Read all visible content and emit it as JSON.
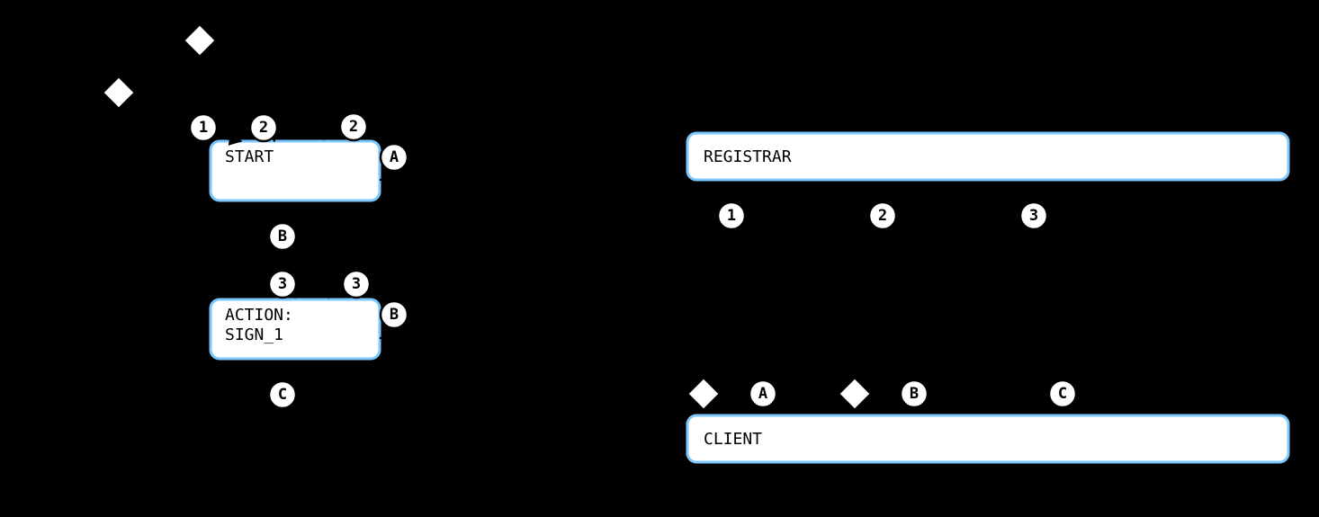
{
  "left": {
    "nodes": {
      "start": "START",
      "action_line1": "ACTION:",
      "action_line2": "SIGN_1"
    },
    "badges": {
      "b1": "1",
      "b2a": "2",
      "b2b": "2",
      "ba": "A",
      "bb": "B",
      "b3a": "3",
      "b3b": "3",
      "bb2": "B",
      "bc": "C"
    }
  },
  "right": {
    "nodes": {
      "registrar": "REGISTRAR",
      "client": "CLIENT"
    },
    "badges": {
      "r1": "1",
      "rA": "A",
      "r2": "2",
      "rB": "B",
      "r3": "3",
      "rC": "C"
    }
  }
}
